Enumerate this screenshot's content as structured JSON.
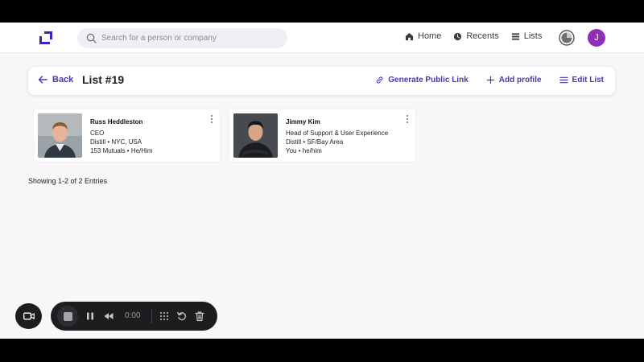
{
  "search": {
    "placeholder": "Search for a person or company"
  },
  "nav": {
    "home": "Home",
    "recents": "Recents",
    "lists": "Lists",
    "avatar_initial": "J"
  },
  "header": {
    "back": "Back",
    "title": "List #19",
    "generate_link": "Generate Public Link",
    "add_profile": "Add profile",
    "edit_list": "Edit List"
  },
  "cards": [
    {
      "name": "Russ Heddleston",
      "title": "CEO",
      "company_location": "Distill • NYC, USA",
      "extra": "153 Mutuals • He/Him"
    },
    {
      "name": "Jimmy Kim",
      "title": "Head of Support & User Experience",
      "company_location": "Distill • SF/Bay Area",
      "extra": "You • he/him"
    }
  ],
  "showing": "Showing 1-2 of 2 Entries",
  "recorder": {
    "time": "0:00"
  },
  "colors": {
    "accent": "#4a35b8",
    "avatar": "#8e2fb5"
  }
}
